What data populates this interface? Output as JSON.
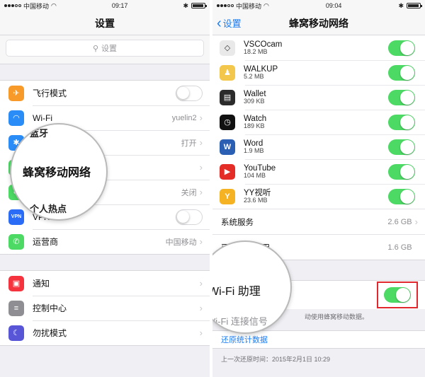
{
  "left": {
    "status": {
      "carrier": "中国移动",
      "time": "09:17"
    },
    "nav_title": "设置",
    "search_placeholder": "设置",
    "rows_group1": [
      {
        "label": "飞行模式",
        "icon": "airplane-icon",
        "color": "#f79a2a",
        "control": "toggle-off"
      },
      {
        "label": "Wi-Fi",
        "icon": "wifi-icon",
        "color": "#2a8cf7",
        "value": "yuelin2",
        "control": "chevron"
      },
      {
        "label": "",
        "icon": "bluetooth-icon",
        "color": "#2a8cf7",
        "value": "打开",
        "control": "chevron"
      },
      {
        "label": "",
        "icon": "cellular-icon",
        "color": "#4cd964",
        "control": "chevron"
      },
      {
        "label": "",
        "icon": "hotspot-icon",
        "color": "#4cd964",
        "value": "关闭",
        "control": "chevron"
      },
      {
        "label": "VPN",
        "icon": "vpn-icon",
        "color": "#2a6cf5",
        "icon_text": "VPN",
        "control": "toggle-off"
      },
      {
        "label": "运营商",
        "icon": "phone-icon",
        "color": "#4cd964",
        "value": "中国移动",
        "control": "chevron"
      }
    ],
    "rows_group2": [
      {
        "label": "通知",
        "icon": "notifications-icon",
        "color": "#f5333f",
        "control": "chevron"
      },
      {
        "label": "控制中心",
        "icon": "control-center-icon",
        "color": "#8e8e93",
        "control": "chevron"
      },
      {
        "label": "勿扰模式",
        "icon": "moon-icon",
        "color": "#5856d6",
        "control": "chevron"
      }
    ],
    "magnifier": {
      "top_partial": "蓝牙",
      "big": "蜂窝移动网络",
      "bottom_partial": "个人热点"
    }
  },
  "right": {
    "status": {
      "carrier": "中国移动",
      "time": "09:04"
    },
    "back_label": "设置",
    "nav_title": "蜂窝移动网络",
    "apps": [
      {
        "name": "VSCOcam",
        "size": "18.2 MB",
        "icon": "vscocam-icon",
        "color": "#e9e9ea"
      },
      {
        "name": "WALKUP",
        "size": "5.2 MB",
        "icon": "walkup-icon",
        "color": "#f3c64c"
      },
      {
        "name": "Wallet",
        "size": "309 KB",
        "icon": "wallet-icon",
        "color": "#2b2b2b"
      },
      {
        "name": "Watch",
        "size": "189 KB",
        "icon": "watch-icon",
        "color": "#111111"
      },
      {
        "name": "Word",
        "size": "1.9 MB",
        "icon": "word-icon",
        "color": "#2b5fb4"
      },
      {
        "name": "YouTube",
        "size": "104 MB",
        "icon": "youtube-icon",
        "color": "#e52d27"
      },
      {
        "name": "YY视听",
        "size": "23.6 MB",
        "icon": "yy-icon",
        "color": "#f5b324"
      }
    ],
    "system_services": {
      "label": "系统服务",
      "value": "2.6 GB"
    },
    "uninstalled": {
      "label": "已卸载的应用",
      "value": "1.6 GB"
    },
    "wifi_assist_note": "动使用蜂窝移动数据。",
    "reset_stats": "还原统计数据",
    "last_reset": "上一次还原时间：2015年2月1日 10:29",
    "magnifier": {
      "big": "Wi-Fi 助理",
      "small": "Wi-Fi 连接信号"
    },
    "accent_color": "#4cd964",
    "highlight_color": "#e0282e"
  }
}
